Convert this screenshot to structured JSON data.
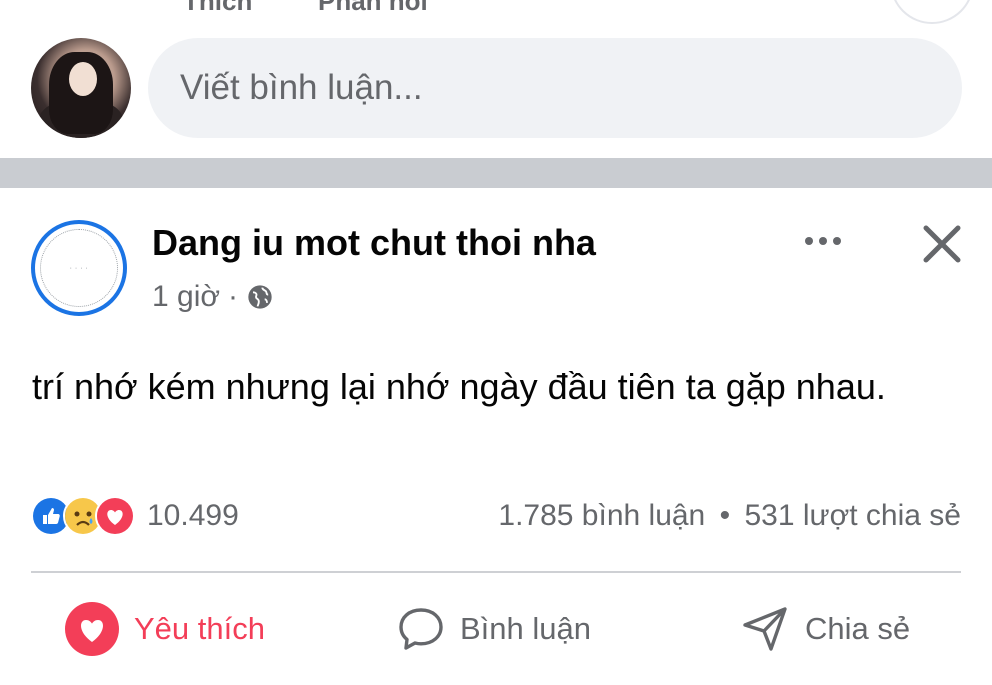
{
  "top_actions": {
    "like_label": "Thích",
    "reply_label": "Phản hồi"
  },
  "comment_box": {
    "placeholder": "Viết bình luận..."
  },
  "post": {
    "author": "Dang iu mot chut thoi nha",
    "time": "1 giờ",
    "separator": "·",
    "privacy_icon": "globe-icon",
    "text": "trí nhớ kém nhưng lại nhớ ngày đầu tiên ta gặp nhau.",
    "reactions": {
      "icons": [
        "like-reaction-icon",
        "sad-reaction-icon",
        "love-reaction-icon"
      ],
      "count": "10.499"
    },
    "stats": {
      "comments": "1.785 bình luận",
      "dot": "•",
      "shares": "531 lượt chia sẻ"
    },
    "actions": {
      "love_label": "Yêu thích",
      "comment_label": "Bình luận",
      "share_label": "Chia sẻ"
    }
  },
  "colors": {
    "accent_blue": "#1b74e4",
    "love_red": "#f33e58",
    "secondary_text": "#65676b",
    "input_bg": "#f0f2f5",
    "divider_band": "#c9ccd1"
  }
}
